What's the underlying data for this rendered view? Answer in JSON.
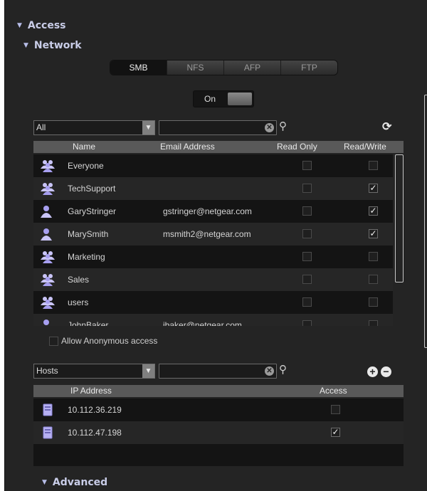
{
  "sections": {
    "access": "Access",
    "network": "Network",
    "advanced": "Advanced"
  },
  "protocol_tabs": [
    {
      "label": "SMB",
      "active": true
    },
    {
      "label": "NFS",
      "active": false
    },
    {
      "label": "AFP",
      "active": false
    },
    {
      "label": "FTP",
      "active": false
    }
  ],
  "service_toggle": {
    "label": "On"
  },
  "users_filter": {
    "selected": "All",
    "search_value": ""
  },
  "users_table": {
    "columns": [
      "Name",
      "Email Address",
      "Read Only",
      "Read/Write"
    ],
    "rows": [
      {
        "type": "group",
        "name": "Everyone",
        "email": "",
        "read_only": false,
        "read_write": false
      },
      {
        "type": "group",
        "name": "TechSupport",
        "email": "",
        "read_only": false,
        "read_write": true
      },
      {
        "type": "user",
        "name": "GaryStringer",
        "email": "gstringer@netgear.com",
        "read_only": false,
        "read_write": true
      },
      {
        "type": "user",
        "name": "MarySmith",
        "email": "msmith2@netgear.com",
        "read_only": false,
        "read_write": true
      },
      {
        "type": "group",
        "name": "Marketing",
        "email": "",
        "read_only": false,
        "read_write": false
      },
      {
        "type": "group",
        "name": "Sales",
        "email": "",
        "read_only": false,
        "read_write": false
      },
      {
        "type": "group",
        "name": "users",
        "email": "",
        "read_only": false,
        "read_write": false
      },
      {
        "type": "user",
        "name": "JohnBaker",
        "email": "jbaker@netgear.com",
        "read_only": false,
        "read_write": false
      }
    ]
  },
  "anonymous_access": {
    "label": "Allow Anonymous access",
    "checked": false
  },
  "hosts_filter": {
    "selected": "Hosts",
    "search_value": ""
  },
  "hosts_table": {
    "columns": [
      "IP Address",
      "Access"
    ],
    "rows": [
      {
        "ip": "10.112.36.219",
        "access": false
      },
      {
        "ip": "10.112.47.198",
        "access": true
      }
    ]
  },
  "icons": {
    "group": "group-icon",
    "user": "user-icon",
    "host": "host-icon",
    "refresh": "refresh-icon",
    "search": "search-icon",
    "add": "add-icon",
    "remove": "remove-icon"
  },
  "colors": {
    "panel_bg": "#242424",
    "header_text": "#c9cde8",
    "user_icon": "#a7a0f0",
    "table_header_bg": "#595959"
  }
}
